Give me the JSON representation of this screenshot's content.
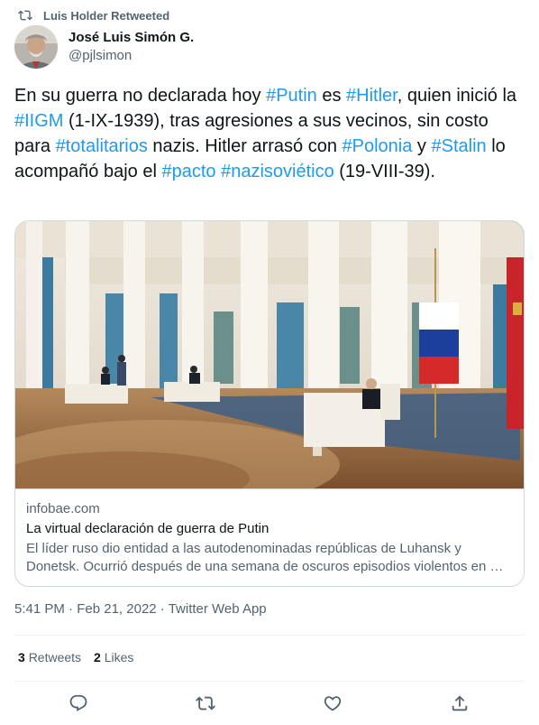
{
  "retweet": {
    "label": "Luis Holder Retweeted",
    "icon": "retweet-icon"
  },
  "author": {
    "display_name": "José Luis Simón G.",
    "handle": "@pjlsimon",
    "avatar_icon": "avatar"
  },
  "tweet": {
    "segments": [
      {
        "text": "En su guerra no declarada hoy ",
        "tag": false
      },
      {
        "text": "#Putin",
        "tag": true
      },
      {
        "text": " es ",
        "tag": false
      },
      {
        "text": "#Hitler",
        "tag": true
      },
      {
        "text": ", quien inició la ",
        "tag": false
      },
      {
        "text": "#IIGM",
        "tag": true
      },
      {
        "text": " (1-IX-1939), tras agresiones a sus vecinos, sin costo para ",
        "tag": false
      },
      {
        "text": "#totalitarios",
        "tag": true
      },
      {
        "text": " nazis. Hitler arrasó con ",
        "tag": false
      },
      {
        "text": "#Polonia",
        "tag": true
      },
      {
        "text": " y ",
        "tag": false
      },
      {
        "text": "#Stalin",
        "tag": true
      },
      {
        "text": " lo acompañó bajo el ",
        "tag": false
      },
      {
        "text": "#pacto",
        "tag": true
      },
      {
        "text": " ",
        "tag": false
      },
      {
        "text": "#nazisoviético",
        "tag": true
      },
      {
        "text": " (19-VIII-39).",
        "tag": false
      }
    ]
  },
  "card": {
    "domain": "infobae.com",
    "title": "La virtual declaración de guerra de Putin",
    "description": "El líder ruso dio entidad a las autodenominadas repúblicas de Luhansk y Donetsk. Ocurrió después de una semana de oscuros episodios violentos en …"
  },
  "timestamp": {
    "time": "5:41 PM",
    "sep1": " · ",
    "date": "Feb 21, 2022",
    "sep2": " · ",
    "source": "Twitter Web App"
  },
  "stats": {
    "retweets_count": "3",
    "retweets_label": "Retweets",
    "likes_count": "2",
    "likes_label": "Likes"
  },
  "actions": [
    "reply-icon",
    "retweet-icon",
    "like-icon",
    "share-icon"
  ],
  "colors": {
    "link": "#1d9bf0",
    "secondary": "#536471",
    "border": "#cfd9de"
  }
}
